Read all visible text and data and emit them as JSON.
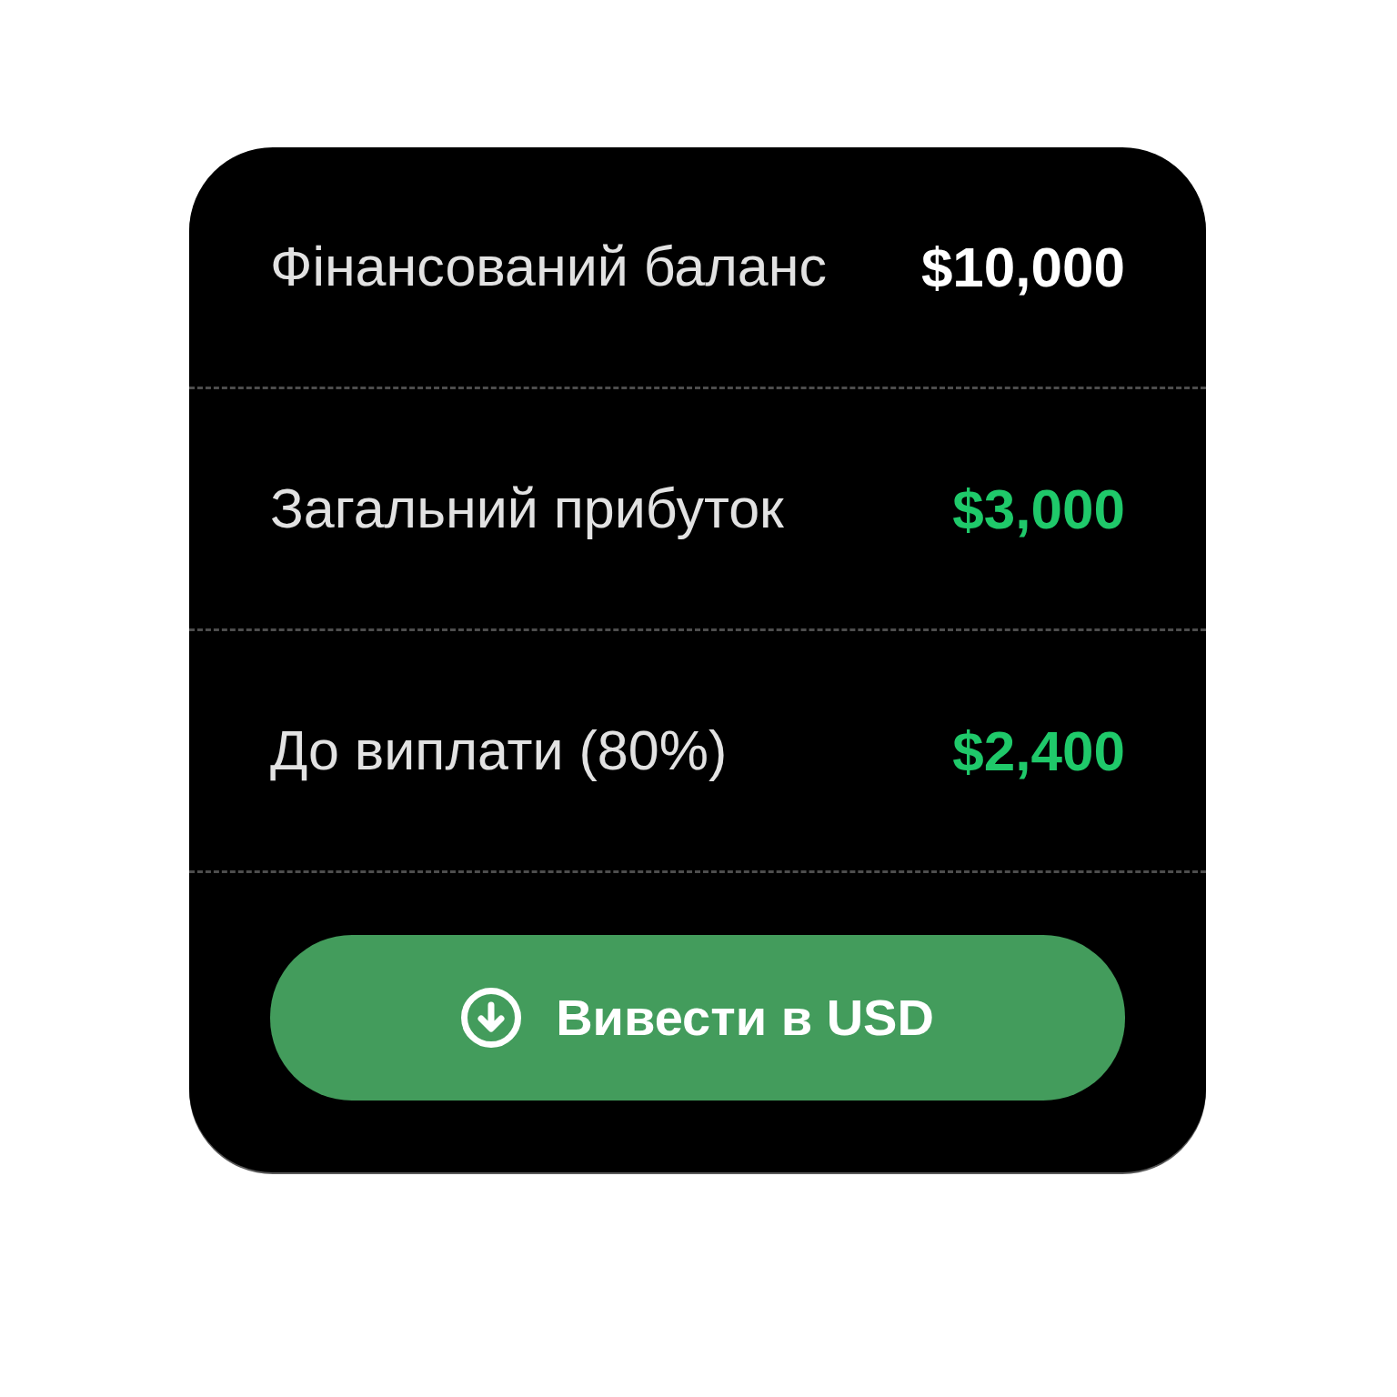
{
  "rows": [
    {
      "label": "Фінансований баланс",
      "amount": "$10,000",
      "color": "#ffffff"
    },
    {
      "label": "Загальний прибуток",
      "amount": "$3,000",
      "color": "#1fc96a"
    },
    {
      "label": "До виплати (80%)",
      "amount": "$2,400",
      "color": "#1fc96a"
    }
  ],
  "button": {
    "label": "Вивести в USD"
  }
}
